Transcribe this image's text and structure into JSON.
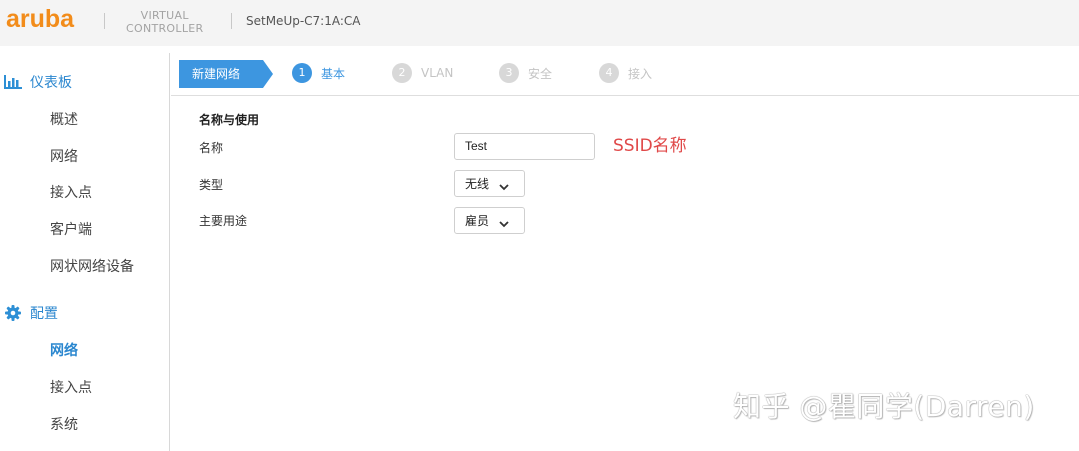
{
  "header": {
    "logo": "aruba",
    "product_line1": "VIRTUAL",
    "product_line2": "CONTROLLER",
    "device_name": "SetMeUp-C7:1A:CA"
  },
  "sidebar": {
    "dashboard": {
      "label": "仪表板",
      "icon": "bar-chart-icon",
      "items": [
        "概述",
        "网络",
        "接入点",
        "客户端",
        "网状网络设备"
      ]
    },
    "config": {
      "label": "配置",
      "icon": "gear-icon",
      "items": [
        "网络",
        "接入点",
        "系统"
      ],
      "active_index": 0
    }
  },
  "wizard": {
    "title": "新建网络",
    "steps": [
      {
        "num": "1",
        "label": "基本",
        "active": true
      },
      {
        "num": "2",
        "label": "VLAN",
        "active": false
      },
      {
        "num": "3",
        "label": "安全",
        "active": false
      },
      {
        "num": "4",
        "label": "接入",
        "active": false
      }
    ]
  },
  "form": {
    "section_title": "名称与使用",
    "name_label": "名称",
    "name_value": "Test",
    "type_label": "类型",
    "type_value": "无线",
    "usage_label": "主要用途",
    "usage_value": "雇员"
  },
  "annotation": "SSID名称",
  "watermark": "知乎 @瞿同学(Darren)",
  "colors": {
    "brand_orange": "#f28c1a",
    "accent_blue": "#3d96e0",
    "annotation_red": "#e04848"
  }
}
